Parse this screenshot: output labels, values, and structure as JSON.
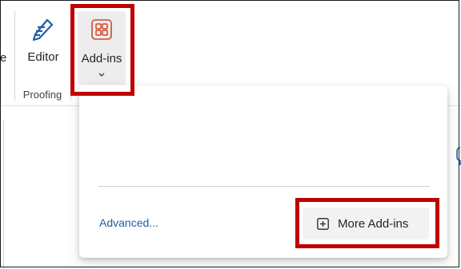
{
  "ribbon": {
    "edge_glyph": "e",
    "editor": {
      "label": "Editor",
      "icon": "editor-pen-icon"
    },
    "group_label": "Proofing",
    "addins": {
      "label": "Add-ins",
      "icon": "addins-grid-icon",
      "accent_color": "#d24726"
    }
  },
  "dropdown": {
    "advanced_link": "Advanced...",
    "more_addins_button": {
      "label": "More Add-ins",
      "icon": "plus-square-icon"
    }
  },
  "colors": {
    "highlight": "#c00000",
    "link": "#1f5ea8",
    "editor_icon": "#1f5ea8"
  }
}
